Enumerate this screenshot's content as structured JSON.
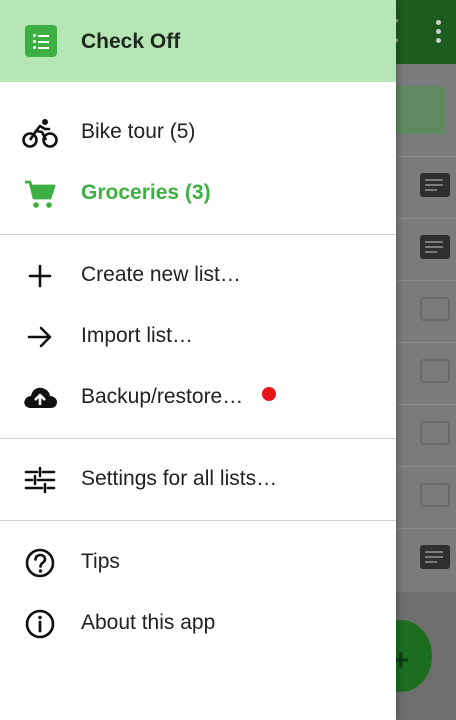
{
  "app": {
    "title": "Check Off"
  },
  "lists": [
    {
      "label": "Bike tour (5)",
      "icon": "bicycle-icon",
      "active": false
    },
    {
      "label": "Groceries (3)",
      "icon": "shopping-cart-icon",
      "active": true
    }
  ],
  "actions": [
    {
      "label": "Create new list…",
      "icon": "plus-icon"
    },
    {
      "label": "Import list…",
      "icon": "arrow-right-icon"
    },
    {
      "label": "Backup/restore…",
      "icon": "cloud-upload-icon",
      "badge": "notification-dot"
    }
  ],
  "settings": {
    "label": "Settings for all lists…",
    "icon": "sliders-icon"
  },
  "help": [
    {
      "label": "Tips",
      "icon": "help-circle-icon"
    },
    {
      "label": "About this app",
      "icon": "info-circle-icon"
    }
  ],
  "colors": {
    "accent": "#3cb043",
    "header_bg": "#b7e6b6",
    "badge": "#e8141c",
    "toolbar_dimmed": "#1d5c1f"
  }
}
